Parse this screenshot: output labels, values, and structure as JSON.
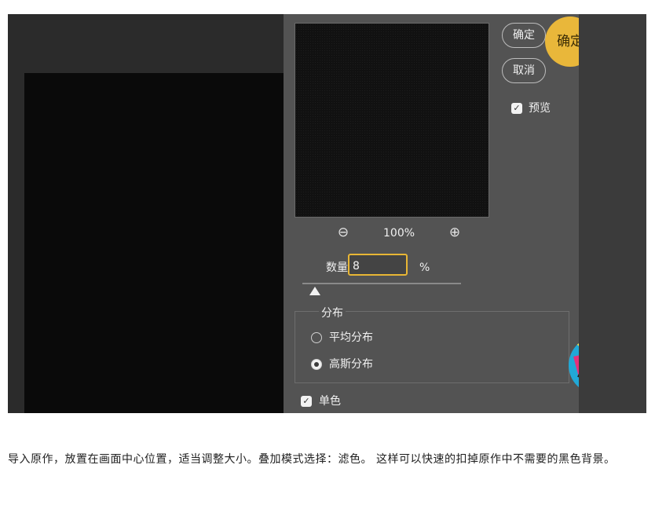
{
  "dialog": {
    "confirm_label": "确定",
    "cancel_label": "取消",
    "callout_label": "确定",
    "preview_label": "预览",
    "zoom_level": "100%",
    "amount_label": "数量:",
    "amount_value": "8",
    "amount_unit": "%",
    "distribution_label": "分布",
    "uniform_label": "平均分布",
    "gaussian_label": "高斯分布",
    "monochrome_label": "单色",
    "selected_distribution": "高斯分布",
    "preview_checked": true,
    "monochrome_checked": true,
    "amount_slider_fraction": 0.08
  },
  "article": {
    "text": "导入原作，放置在画面中心位置，适当调整大小。叠加模式选择：滤色。 这样可以快速的扣掉原作中不需要的黑色背景。"
  },
  "colors": {
    "accent": "#e9b73a",
    "dialog_bg": "#535353",
    "workspace_bg": "#2b2b2b"
  }
}
